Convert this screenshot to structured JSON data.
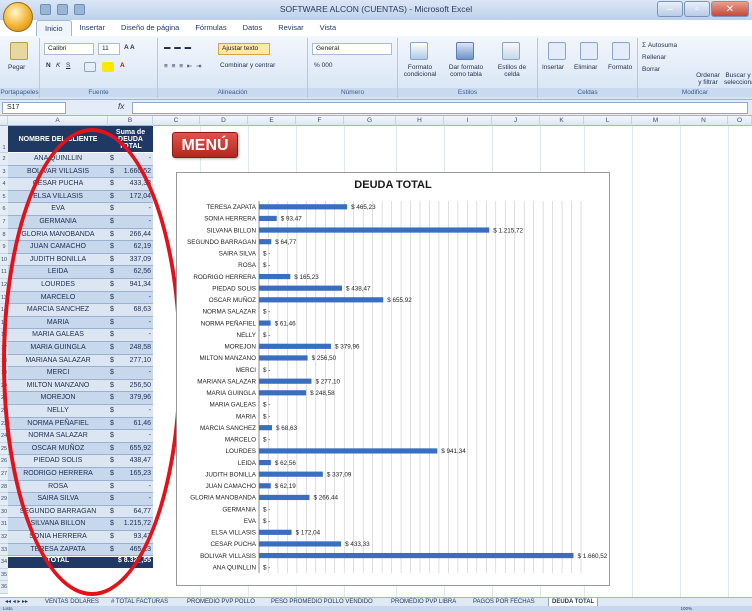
{
  "window": {
    "title": "SOFTWARE ALCON (CUENTAS) - Microsoft Excel"
  },
  "ribbon": {
    "tabs": [
      "Inicio",
      "Insertar",
      "Diseño de página",
      "Fórmulas",
      "Datos",
      "Revisar",
      "Vista"
    ],
    "groups": {
      "portapapeles": "Portapapeles",
      "fuente": "Fuente",
      "alineacion": "Alineación",
      "numero": "Número",
      "estilos": "Estilos",
      "celdas": "Celdas",
      "modificar": "Modificar"
    },
    "paste": "Pegar",
    "font_name": "Calibri",
    "font_size": "11",
    "wrap_text": "Ajustar texto",
    "merge_center": "Combinar y centrar",
    "number_format": "General",
    "cond_format": "Formato condicional",
    "format_table": "Dar formato como tabla",
    "cell_styles": "Estilos de celda",
    "insert": "Insertar",
    "delete": "Eliminar",
    "format": "Formato",
    "autosum": "Autosuma",
    "fill": "Rellenar",
    "clear": "Borrar",
    "sort_filter": "Ordenar y filtrar",
    "find_select": "Buscar y seleccionar",
    "percent": "% 000"
  },
  "formula_bar": {
    "name_box": "S17",
    "fx": "fx"
  },
  "columns": [
    "A",
    "B",
    "C",
    "D",
    "E",
    "F",
    "G",
    "H",
    "I",
    "J",
    "K",
    "L",
    "M",
    "N",
    "O"
  ],
  "table": {
    "header_name": "NOMBRE DEL CLIENTE",
    "header_sum": "Suma de DEUDA TOTAL",
    "currency": "$",
    "rows": [
      {
        "name": "ANA QUINLLIN",
        "value": "-"
      },
      {
        "name": "BOLIVAR VILLASIS",
        "value": "1.660,52"
      },
      {
        "name": "CESAR PUCHA",
        "value": "433,33"
      },
      {
        "name": "ELSA VILLASIS",
        "value": "172,04"
      },
      {
        "name": "EVA",
        "value": "-"
      },
      {
        "name": "GERMANIA",
        "value": "-"
      },
      {
        "name": "GLORIA MANOBANDA",
        "value": "266,44"
      },
      {
        "name": "JUAN CAMACHO",
        "value": "62,19"
      },
      {
        "name": "JUDITH BONILLA",
        "value": "337,09"
      },
      {
        "name": "LEIDA",
        "value": "62,56"
      },
      {
        "name": "LOURDES",
        "value": "941,34"
      },
      {
        "name": "MARCELO",
        "value": "-"
      },
      {
        "name": "MARCIA SANCHEZ",
        "value": "68,63"
      },
      {
        "name": "MARIA",
        "value": "-"
      },
      {
        "name": "MARIA GALEAS",
        "value": "-"
      },
      {
        "name": "MARIA GUINGLA",
        "value": "248,58"
      },
      {
        "name": "MARIANA SALAZAR",
        "value": "277,10"
      },
      {
        "name": "MERCI",
        "value": "-"
      },
      {
        "name": "MILTON MANZANO",
        "value": "256,50"
      },
      {
        "name": "MOREJON",
        "value": "379,96"
      },
      {
        "name": "NELLY",
        "value": "-"
      },
      {
        "name": "NORMA PEÑAFIEL",
        "value": "61,46"
      },
      {
        "name": "NORMA SALAZAR",
        "value": "-"
      },
      {
        "name": "OSCAR MUÑOZ",
        "value": "655,92"
      },
      {
        "name": "PIEDAD SOLIS",
        "value": "438,47"
      },
      {
        "name": "RODRIGO HERRERA",
        "value": "165,23"
      },
      {
        "name": "ROSA",
        "value": "-"
      },
      {
        "name": "SAIRA SILVA",
        "value": "-"
      },
      {
        "name": "SEGUNDO BARRAGAN",
        "value": "64,77"
      },
      {
        "name": "SILVANA BILLON",
        "value": "1.215,72"
      },
      {
        "name": "SONIA HERRERA",
        "value": "93,47"
      },
      {
        "name": "TERESA ZAPATA",
        "value": "465,23"
      }
    ],
    "total_label": "TOTAL",
    "total_value": "$ 8.32_,55"
  },
  "menu_button": "MENÚ",
  "chart_data": {
    "type": "bar",
    "orientation": "horizontal",
    "title": "DEUDA TOTAL",
    "xlim": [
      0,
      1700
    ],
    "grid": true,
    "categories": [
      "TERESA ZAPATA",
      "SONIA HERRERA",
      "SILVANA BILLON",
      "SEGUNDO BARRAGAN",
      "SAIRA SILVA",
      "ROSA",
      "RODRIGO HERRERA",
      "PIEDAD SOLIS",
      "OSCAR MUÑOZ",
      "NORMA SALAZAR",
      "NORMA PEÑAFIEL",
      "NELLY",
      "MOREJON",
      "MILTON MANZANO",
      "MERCI",
      "MARIANA SALAZAR",
      "MARIA GUINGLA",
      "MARIA GALEAS",
      "MARIA",
      "MARCIA SANCHEZ",
      "MARCELO",
      "LOURDES",
      "LEIDA",
      "JUDITH BONILLA",
      "JUAN CAMACHO",
      "GLORIA MANOBANDA",
      "GERMANIA",
      "EVA",
      "ELSA VILLASIS",
      "CESAR PUCHA",
      "BOLIVAR VILLASIS",
      "ANA QUINLLIN"
    ],
    "values": [
      465.23,
      93.47,
      1215.72,
      64.77,
      0,
      0,
      165.23,
      438.47,
      655.92,
      0,
      61.46,
      0,
      379.96,
      256.5,
      0,
      277.1,
      248.58,
      0,
      0,
      68.63,
      0,
      941.34,
      62.56,
      337.09,
      62.19,
      266.44,
      0,
      0,
      172.04,
      433.33,
      1660.52,
      0
    ],
    "labels": [
      "$ 465,23",
      "$ 93,47",
      "$ 1.215,72",
      "$ 64,77",
      "$ -",
      "$ -",
      "$ 165,23",
      "$ 438,47",
      "$ 655,92",
      "$ -",
      "$ 61,46",
      "$ -",
      "$ 379,96",
      "$ 256,50",
      "$ -",
      "$ 277,10",
      "$ 248,58",
      "$ -",
      "$ -",
      "$ 68,63",
      "$ -",
      "$ 941,34",
      "$ 62,56",
      "$ 337,09",
      "$ 62,19",
      "$ 266,44",
      "$ -",
      "$ -",
      "$ 172,04",
      "$ 433,33",
      "$ 1.660,52",
      "$ -"
    ]
  },
  "sheet_tabs": [
    "VENTAS DOLARES",
    "# TOTAL FACTURAS",
    "PROMEDIO PVP POLLO",
    "PESO PROMEDIO POLLO VENDIDO",
    "PROMEDIO PVP LIBRA",
    "PAGOS POR FECHAS",
    "DEUDA TOTAL"
  ],
  "status": {
    "ready": "Listo",
    "zoom": "100%"
  },
  "colors": {
    "table_header": "#1f3864",
    "menu_red": "#c0352b",
    "bar_blue": "#3a6fc0",
    "annotation_red": "#e3121a"
  }
}
